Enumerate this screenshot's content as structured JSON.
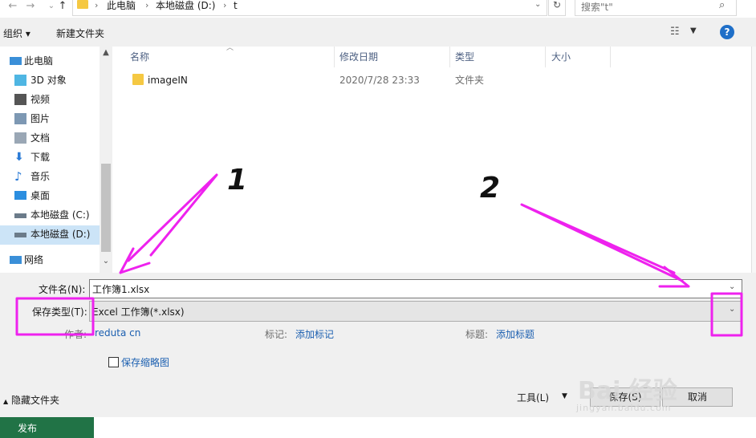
{
  "address": {
    "crumbs": [
      "此电脑",
      "本地磁盘 (D:)",
      "t"
    ],
    "search_placeholder": "搜索\"t\""
  },
  "toolbar": {
    "organize_label": "组织 ▾",
    "new_folder_label": "新建文件夹"
  },
  "nav": {
    "items": [
      {
        "label": "此电脑",
        "icon": "pc-icon"
      },
      {
        "label": "3D 对象",
        "icon": "cube-icon"
      },
      {
        "label": "视频",
        "icon": "video-icon"
      },
      {
        "label": "图片",
        "icon": "picture-icon"
      },
      {
        "label": "文档",
        "icon": "document-icon"
      },
      {
        "label": "下载",
        "icon": "download-icon"
      },
      {
        "label": "音乐",
        "icon": "music-icon"
      },
      {
        "label": "桌面",
        "icon": "desktop-icon"
      },
      {
        "label": "本地磁盘 (C:)",
        "icon": "drive-icon"
      },
      {
        "label": "本地磁盘 (D:)",
        "icon": "drive-icon"
      },
      {
        "label": "网络",
        "icon": "network-icon"
      }
    ],
    "selected": "本地磁盘 (D:)"
  },
  "columns": {
    "name": "名称",
    "modified": "修改日期",
    "type": "类型",
    "size": "大小"
  },
  "files": [
    {
      "name": "imageIN",
      "modified": "2020/7/28 23:33",
      "type": "文件夹",
      "size": ""
    }
  ],
  "form": {
    "filename_label": "文件名(N):",
    "filename_value": "工作簿1.xlsx",
    "filetype_label": "保存类型(T):",
    "filetype_value": "Excel 工作簿(*.xlsx)",
    "author_label": "作者:",
    "author_value": "reduta cn",
    "tags_label": "标记:",
    "tags_value": "添加标记",
    "title_label": "标题:",
    "title_value": "添加标题",
    "thumbnail_label": "保存缩略图"
  },
  "footer": {
    "hide_folders": "隐藏文件夹",
    "tools_label": "工具(L)",
    "save_label": "保存(S)",
    "cancel_label": "取消",
    "publish_label": "发布"
  },
  "annotations": {
    "num1": "1",
    "num2": "2"
  },
  "colors": {
    "annotation": "#ee22ee",
    "accent": "#1f6fc8",
    "excel_green": "#217346",
    "selection": "#cce4f7"
  }
}
